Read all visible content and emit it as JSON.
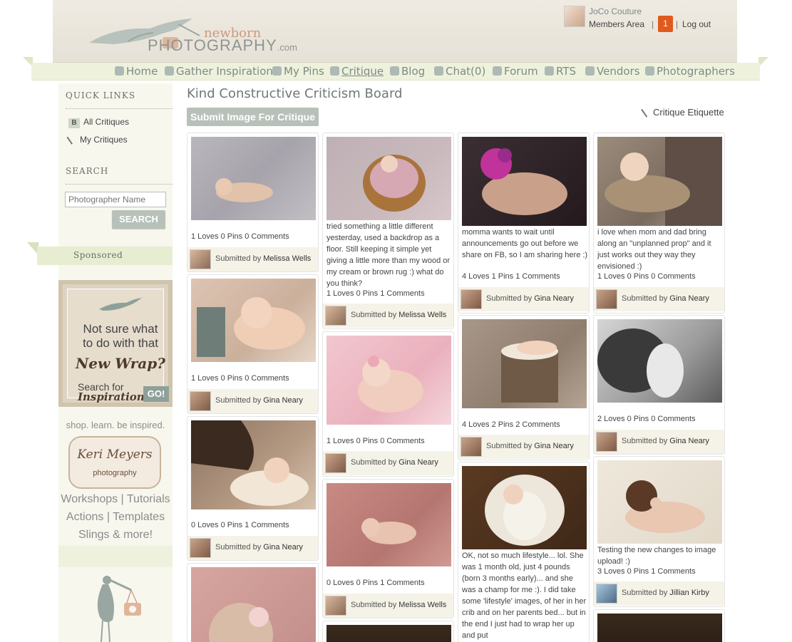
{
  "header": {
    "logo_top": "newborn",
    "logo_main": "PHOTOGRAPHY",
    "logo_suffix": ".com",
    "user_name": "JoCo Couture",
    "members_area": "Members Area",
    "notifications": "1",
    "logout": "Log out",
    "separator": "|"
  },
  "nav": {
    "items": [
      {
        "label": "Home",
        "icon": "home-icon"
      },
      {
        "label": "Gather Inspiration",
        "icon": "lightbulb-icon"
      },
      {
        "label": "My Pins",
        "icon": "pin-icon"
      },
      {
        "label": "Critique",
        "icon": "heart-icon",
        "active": true
      },
      {
        "label": "Blog",
        "icon": "star-icon"
      },
      {
        "label": "Chat(0)",
        "icon": "chat-icon"
      },
      {
        "label": "Forum",
        "icon": "forum-icon"
      },
      {
        "label": "RTS",
        "icon": "tag-icon"
      },
      {
        "label": "Vendors",
        "icon": "bulb-icon"
      },
      {
        "label": "Photographers",
        "icon": "camera-icon"
      }
    ]
  },
  "sidebar": {
    "quick_links_title": "QUICK LINKS",
    "quick_links": [
      {
        "label": "All Critiques",
        "badge": "B"
      },
      {
        "label": "My Critiques"
      }
    ],
    "search_title": "SEARCH",
    "search_placeholder": "Photographer Name",
    "search_button": "SEARCH",
    "sponsored": "Sponsored",
    "ad1": {
      "line1": "Not sure what",
      "line2": "to do with that",
      "line3": "New Wrap?",
      "line4": "Search for",
      "line5": "Inspiration",
      "go": "GO!"
    },
    "ad2": {
      "tagline": "shop. learn. be inspired.",
      "name": "Keri Meyers",
      "sub": "photography",
      "line1": "Workshops | Tutorials",
      "line2": "Actions | Templates",
      "line3": "Slings & more!"
    }
  },
  "main": {
    "title": "Kind Constructive Criticism Board",
    "submit_button": "Submit Image For Critique",
    "etiquette_link": "Critique Etiquette",
    "submitted_by_prefix": "Submitted by",
    "cards": [
      {
        "caption": "",
        "stats": "1 Loves 0 Pins 0 Comments",
        "author": "Melissa Wells"
      },
      {
        "caption": "",
        "stats": "1 Loves 0 Pins 0 Comments",
        "author": "Gina Neary"
      },
      {
        "caption": "",
        "stats": "0 Loves 0 Pins 1 Comments",
        "author": "Gina Neary"
      },
      {
        "caption": "tried something a little different yesterday, used a backdrop as a floor. Still keeping it simple yet giving a little more than my wood or my cream or brown rug :) what do you think?",
        "stats": "1 Loves 0 Pins 1 Comments",
        "author": "Melissa Wells"
      },
      {
        "caption": "",
        "stats": "1 Loves 0 Pins 0 Comments",
        "author": "Gina Neary"
      },
      {
        "caption": "",
        "stats": "0 Loves 0 Pins 1 Comments",
        "author": "Melissa Wells"
      },
      {
        "caption": "momma wants to wait until announcements go out before we share on FB, so I am sharing here :)",
        "stats": "4 Loves 1 Pins 1 Comments",
        "author": "Gina Neary"
      },
      {
        "caption": "",
        "stats": "4 Loves 2 Pins 2 Comments",
        "author": "Gina Neary"
      },
      {
        "caption": "OK, not so much lifestyle... lol. She was 1 month old, just 4 pounds (born 3 months early)... and she was a champ for me :). I did take some 'lifestyle' images, of her in her crib and on her parents bed... but in the end I just had to wrap her up and put",
        "stats": "",
        "author": ""
      },
      {
        "caption": "i love when mom and dad bring along an \"unplanned prop\" and it just works out they way they envisioned :)",
        "stats": "1 Loves 0 Pins 0 Comments",
        "author": "Gina Neary"
      },
      {
        "caption": "",
        "stats": "2 Loves 0 Pins 0 Comments",
        "author": "Gina Neary"
      },
      {
        "caption": "Testing the new changes to image upload! :)",
        "stats": "3 Loves 0 Pins 1 Comments",
        "author": "Jillian Kirby"
      }
    ]
  }
}
